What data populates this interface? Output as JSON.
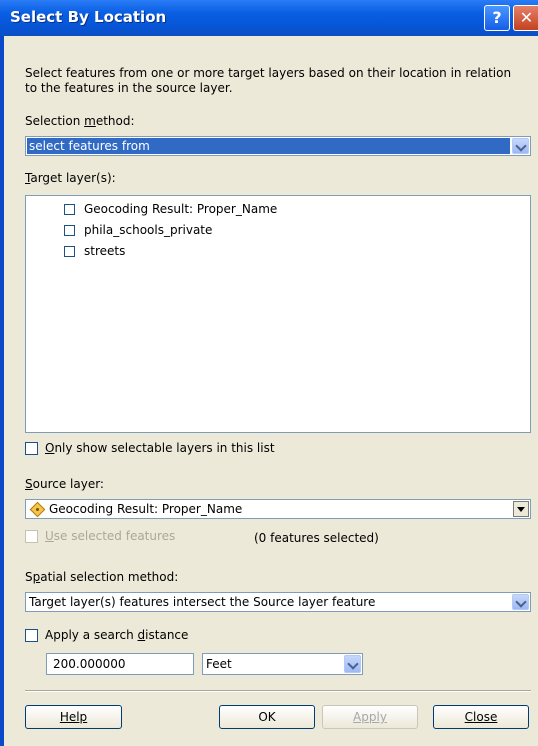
{
  "window": {
    "title": "Select By Location"
  },
  "description": "Select features from one or more target layers based on their location in relation to the features in the source layer.",
  "selection_method": {
    "label": "Selection method:",
    "value": "select features from"
  },
  "target_layers": {
    "label": "Target layer(s):",
    "items": [
      {
        "label": "Geocoding Result: Proper_Name",
        "checked": false
      },
      {
        "label": "phila_schools_private",
        "checked": false
      },
      {
        "label": "streets",
        "checked": false
      }
    ]
  },
  "only_selectable": {
    "label": "Only show selectable layers in this list",
    "checked": false
  },
  "source_layer": {
    "label": "Source layer:",
    "value": "Geocoding Result: Proper_Name",
    "icon": "point-layer-icon"
  },
  "use_selected": {
    "label": "Use selected features",
    "checked": false,
    "enabled": false
  },
  "features_selected": "(0 features selected)",
  "spatial_method": {
    "label": "Spatial selection method:",
    "value": "Target layer(s) features intersect the Source layer feature"
  },
  "search_distance": {
    "label": "Apply a search distance",
    "checked": false,
    "value": "200.000000",
    "unit": "Feet"
  },
  "buttons": {
    "help": "Help",
    "ok": "OK",
    "apply": "Apply",
    "close": "Close"
  },
  "colors": {
    "titlebar": "#0a5fe3",
    "dialog_bg": "#ece9d8",
    "selection_highlight": "#316ac5"
  }
}
